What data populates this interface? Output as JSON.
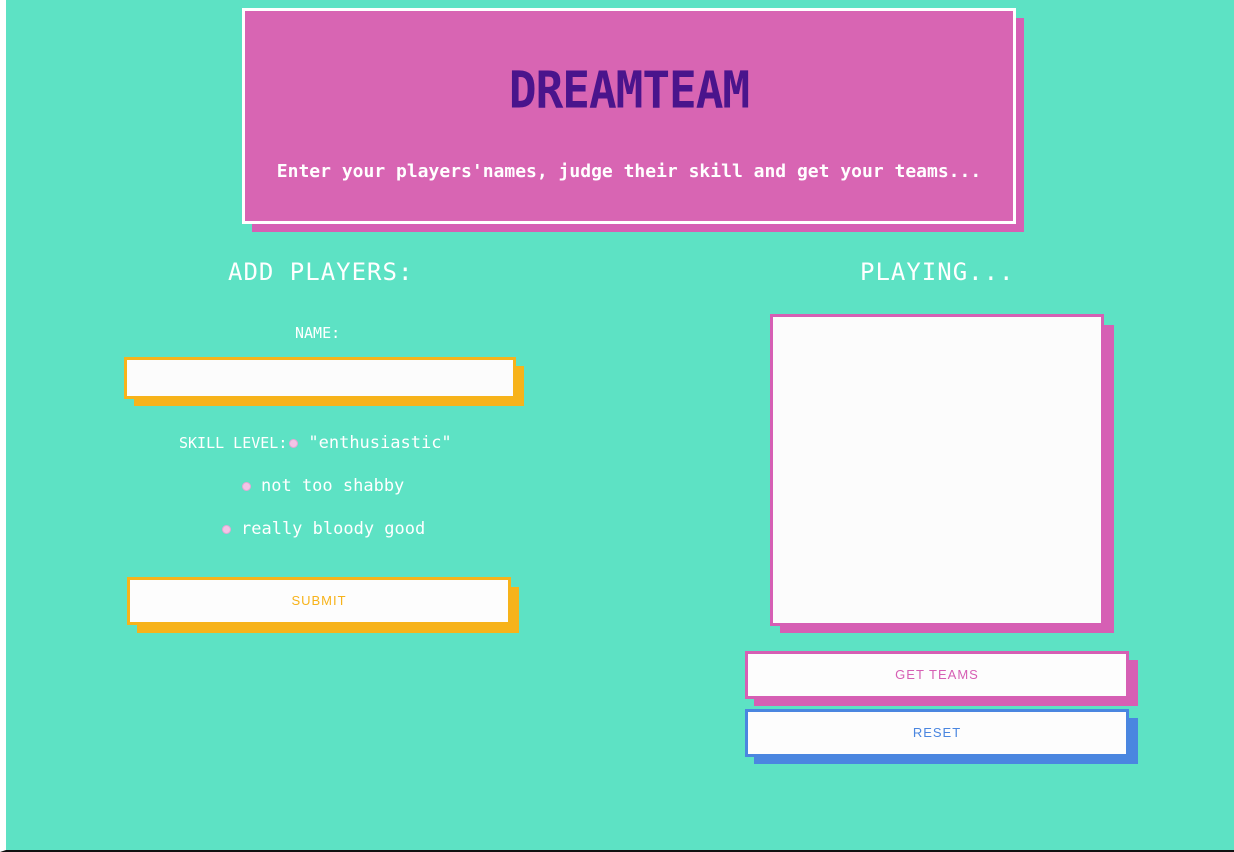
{
  "header": {
    "title": "DREAMTEAM",
    "subtitle": "Enter your players'names, judge their skill and get your teams..."
  },
  "add_players": {
    "title": "ADD PLAYERS:",
    "name_label": "NAME:",
    "name_value": "",
    "skill_label": "SKILL LEVEL:",
    "skill_options": [
      "\"enthusiastic\"",
      "not too shabby",
      "really bloody good"
    ],
    "submit_label": "SUBMIT"
  },
  "playing": {
    "title": "PLAYING...",
    "get_teams_label": "GET TEAMS",
    "reset_label": "RESET"
  },
  "colors": {
    "background": "#5de2c4",
    "header": "#d865b3",
    "title": "#4a148c",
    "yellow": "#f7b31a",
    "pink": "#d65fb4",
    "blue": "#4a86e0"
  }
}
